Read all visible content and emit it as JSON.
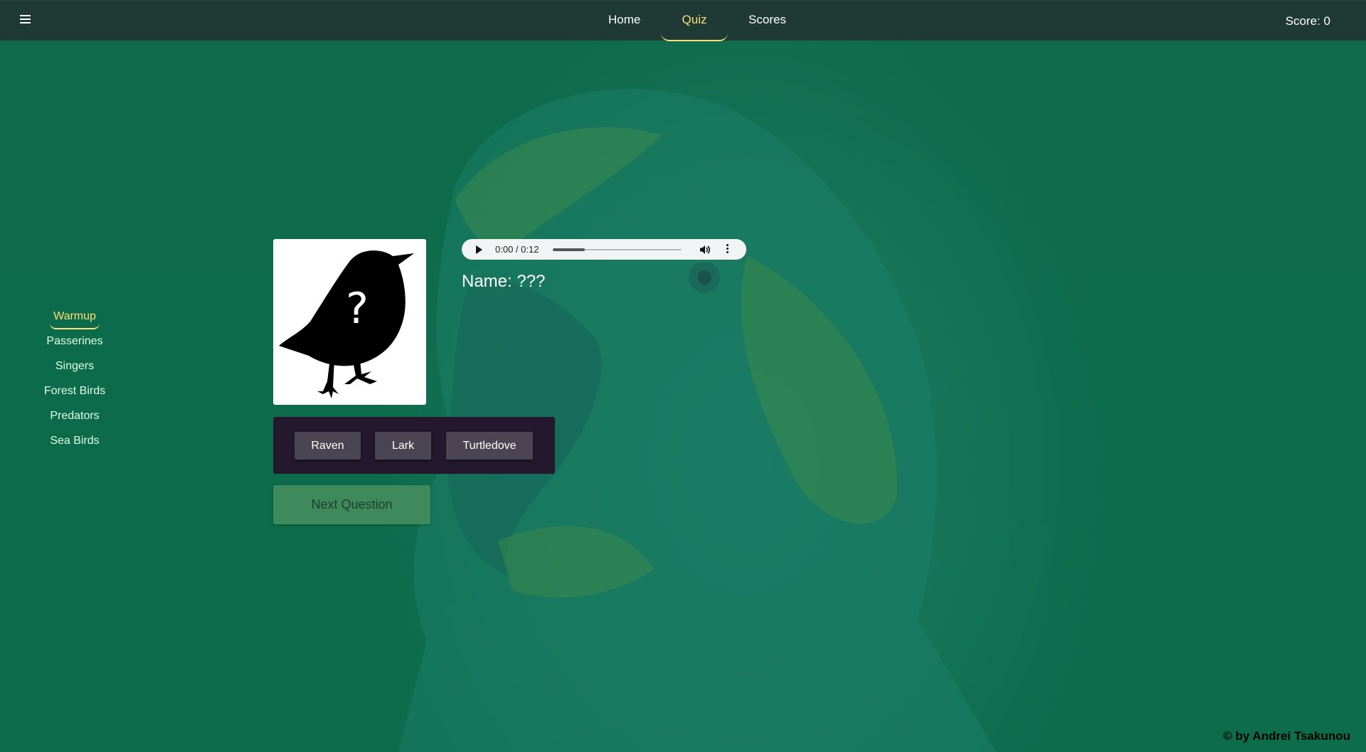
{
  "nav": {
    "menu_icon": "hamburger-menu-icon",
    "items": [
      {
        "label": "Home",
        "active": false
      },
      {
        "label": "Quiz",
        "active": true
      },
      {
        "label": "Scores",
        "active": false
      }
    ],
    "active_color": "#ffdf7a"
  },
  "score": {
    "text": "Score: 0"
  },
  "sidebar": {
    "items": [
      {
        "label": "Warmup",
        "active": true
      },
      {
        "label": "Passerines",
        "active": false
      },
      {
        "label": "Singers",
        "active": false
      },
      {
        "label": "Forest Birds",
        "active": false
      },
      {
        "label": "Predators",
        "active": false
      },
      {
        "label": "Sea Birds",
        "active": false
      }
    ]
  },
  "question": {
    "image_icon": "unknown-bird-silhouette-icon",
    "mark": "?",
    "audio": {
      "time": "0:00 / 0:12",
      "progress": 0.25
    },
    "name": "Name: ???"
  },
  "answers": [
    "Raven",
    "Lark",
    "Turtledove"
  ],
  "next_button": {
    "label": "Next Question",
    "enabled": false
  },
  "footer": {
    "text": "© by Andrei Tsakunou"
  },
  "colors": {
    "background": "#0d6a4a",
    "topbar": "#1f3a35",
    "answers_panel": "#23182e",
    "answer_button": "#4b4453",
    "next_button": "#3f8a5c"
  }
}
